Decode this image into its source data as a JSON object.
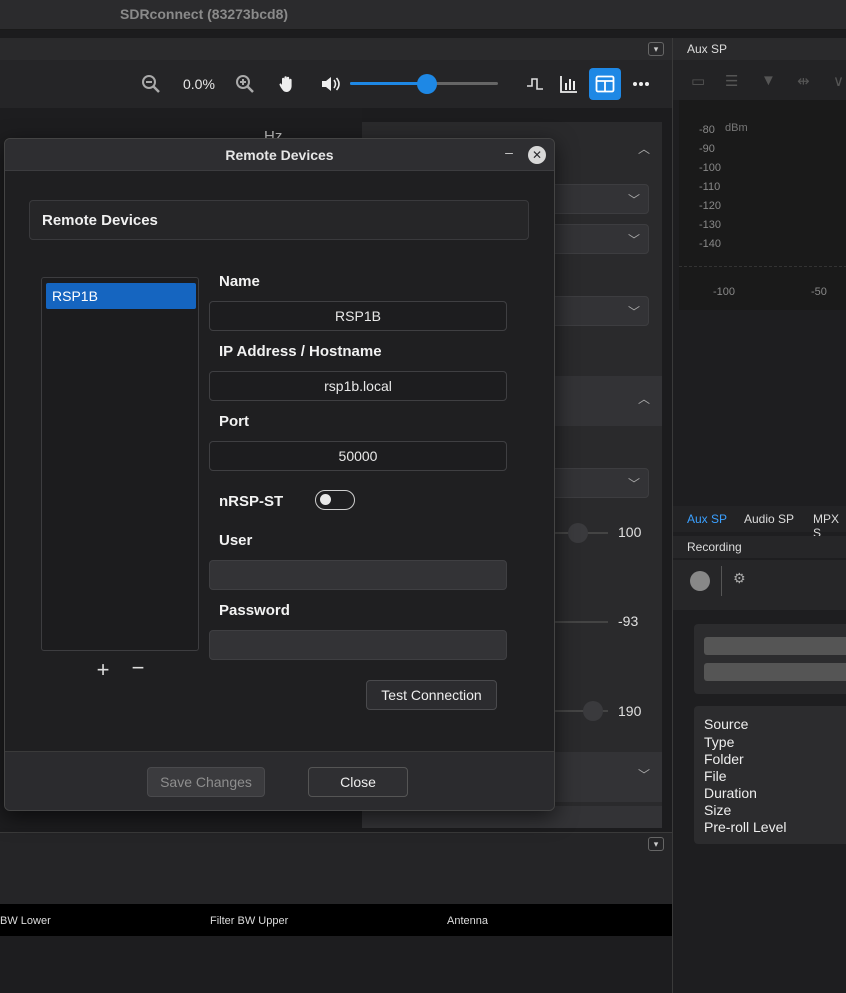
{
  "window": {
    "title": "SDRconnect (83273bcd8)"
  },
  "toolbar": {
    "zoom_value": "0.0%",
    "volume_fraction": 0.52,
    "icons": [
      "zoom-out-icon",
      "zoom-in-icon",
      "pan-hand-icon",
      "speaker-icon",
      "waveform-icon",
      "chart-icon",
      "layout-icon",
      "more-icon"
    ]
  },
  "background": {
    "hz_label": "Hz",
    "value_100": "100",
    "value_93": "-93",
    "value_190": "190"
  },
  "aux": {
    "title": "Aux SP",
    "db_unit": "dBm",
    "db_labels": [
      "-80",
      "-90",
      "-100",
      "-110",
      "-120",
      "-130",
      "-140"
    ],
    "x_labels": [
      "-100",
      "-50"
    ]
  },
  "sp_tabs": [
    "Aux SP",
    "Audio SP",
    "MPX S"
  ],
  "recording": {
    "title": "Recording",
    "info_labels": [
      "Source",
      "Type",
      "Folder",
      "File",
      "Duration",
      "Size",
      "Pre-roll Level"
    ]
  },
  "table": {
    "headers": [
      "BW Lower",
      "Filter BW Upper",
      "Antenna"
    ]
  },
  "dialog": {
    "title": "Remote Devices",
    "header": "Remote Devices",
    "devices": [
      "RSP1B"
    ],
    "fields": {
      "name_label": "Name",
      "name_value": "RSP1B",
      "ip_label": "IP Address / Hostname",
      "ip_value": "rsp1b.local",
      "port_label": "Port",
      "port_value": "50000",
      "nrsp_label": "nRSP-ST",
      "nrsp_on": false,
      "user_label": "User",
      "user_value": "",
      "password_label": "Password",
      "password_value": ""
    },
    "add_label": "+",
    "remove_label": "−",
    "test_label": "Test Connection",
    "save_label": "Save Changes",
    "close_label": "Close"
  },
  "colors": {
    "accent": "#1e88e5",
    "selection": "#1565c0"
  }
}
